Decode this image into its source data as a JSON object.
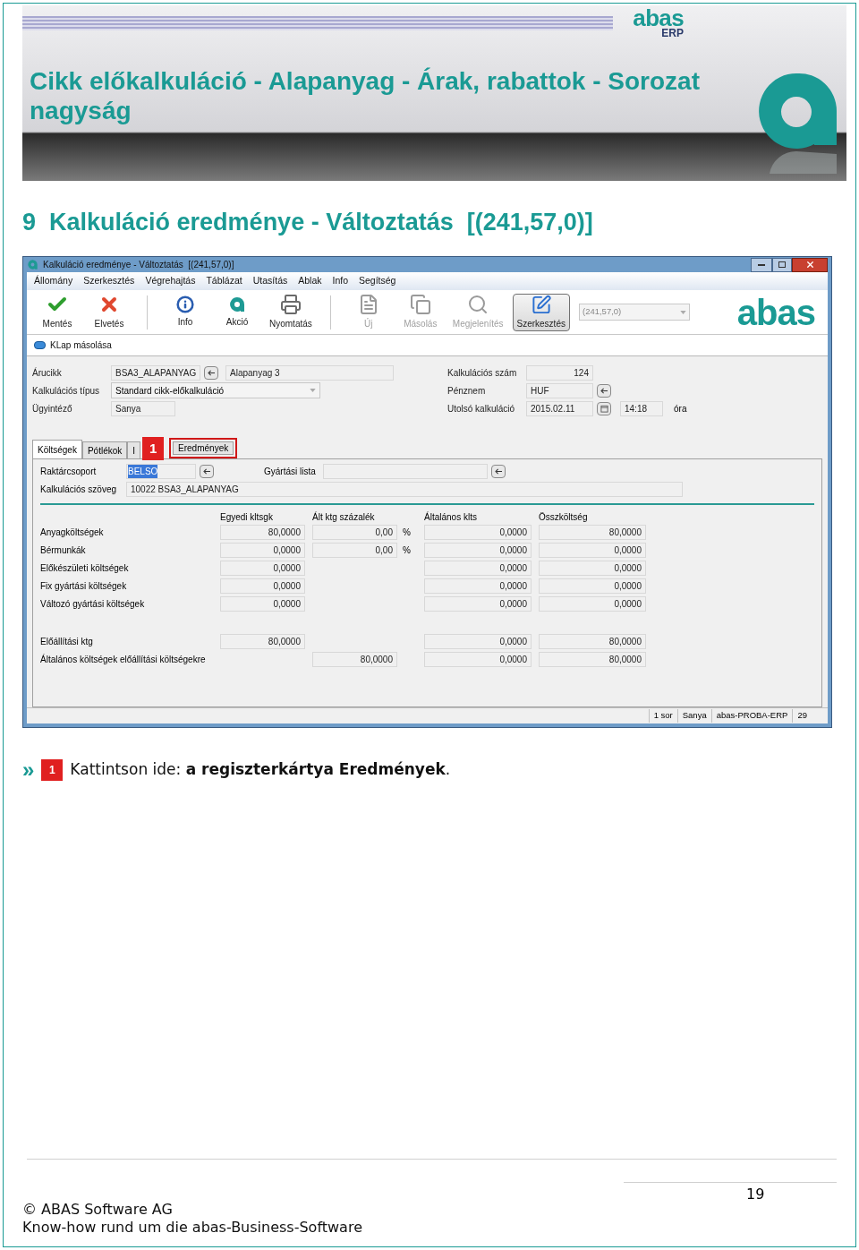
{
  "banner": {
    "logo": "abas",
    "logo_sub": "ERP",
    "title": "Cikk előkalkuláció - Alapanyag - Árak, rabattok - Sorozat nagyság"
  },
  "section": {
    "number": "9",
    "title": "Kalkuláció eredménye - Változtatás  [(241,57,0)]"
  },
  "window": {
    "title": "Kalkuláció eredménye - Változtatás  [(241,57,0)]",
    "menu": [
      "Állomány",
      "Szerkesztés",
      "Végrehajtás",
      "Táblázat",
      "Utasítás",
      "Ablak",
      "Info",
      "Segítség"
    ],
    "toolbar": [
      {
        "kind": "save",
        "label": "Mentés",
        "disabled": false,
        "selected": false
      },
      {
        "kind": "discard",
        "label": "Elvetés",
        "disabled": false,
        "selected": false
      },
      {
        "kind": "separator"
      },
      {
        "kind": "info",
        "label": "Info",
        "disabled": false,
        "selected": false
      },
      {
        "kind": "action",
        "label": "Akció",
        "disabled": false,
        "selected": false
      },
      {
        "kind": "print",
        "label": "Nyomtatás",
        "disabled": false,
        "selected": false
      },
      {
        "kind": "separator"
      },
      {
        "kind": "new",
        "label": "Új",
        "disabled": true,
        "selected": false
      },
      {
        "kind": "copy",
        "label": "Másolás",
        "disabled": true,
        "selected": false
      },
      {
        "kind": "view",
        "label": "Megjelenítés",
        "disabled": true,
        "selected": false
      },
      {
        "kind": "edit",
        "label": "Szerkesztés",
        "disabled": false,
        "selected": true
      }
    ],
    "record_select": {
      "value": "(241,57,0)"
    },
    "logo": "abas",
    "action": "KLap másolása",
    "fields_left": [
      {
        "label": "Árucikk",
        "kind": "lookup",
        "value": "BSA3_ALAPANYAG",
        "extra": "Alapanyag 3"
      },
      {
        "label": "Kalkulációs típus",
        "kind": "select",
        "value": "Standard cikk-előkalkuláció"
      },
      {
        "label": "Ügyintéző",
        "kind": "text",
        "value": "Sanya"
      }
    ],
    "fields_right": [
      {
        "label": "Kalkulációs szám",
        "kind": "number",
        "value": "124"
      },
      {
        "label": "Pénznem",
        "kind": "lookup",
        "value": "HUF"
      },
      {
        "label": "Utolsó kalkuláció",
        "kind": "date",
        "value": "2015.02.11",
        "time": "14:18",
        "unit": "óra"
      }
    ],
    "tabs": [
      {
        "label": "Költségek",
        "selected": true,
        "highlighted": false
      },
      {
        "label": "Pótlékok",
        "selected": false,
        "highlighted": false
      },
      {
        "label": "I",
        "selected": false,
        "highlighted": false
      },
      {
        "label": "Eredmények",
        "selected": false,
        "highlighted": true
      }
    ],
    "callout": "1",
    "stock_group": {
      "label": "Raktárcsoport",
      "value": "BELSO",
      "text_selected": true
    },
    "production_list": {
      "label": "Gyártási lista"
    },
    "calc_text": {
      "label": "Kalkulációs szöveg",
      "value": "10022 BSA3_ALAPANYAG"
    },
    "cost_columns": [
      "Egyedi kltsgk",
      "Ált ktg százalék",
      "Általános klts",
      "Összköltség"
    ],
    "cost_rows": [
      {
        "label": "Anyagköltségek",
        "cells": [
          "80,0000",
          "0,00",
          "0,0000",
          "80,0000"
        ],
        "unit": "%"
      },
      {
        "label": "Bérmunkák",
        "cells": [
          "0,0000",
          "0,00",
          "0,0000",
          "0,0000"
        ],
        "unit": "%"
      },
      {
        "label": "Előkészületi költségek",
        "cells": [
          "0,0000",
          null,
          "0,0000",
          "0,0000"
        ]
      },
      {
        "label": "Fix gyártási költségek",
        "cells": [
          "0,0000",
          null,
          "0,0000",
          "0,0000"
        ]
      },
      {
        "label": "Változó gyártási költségek",
        "cells": [
          "0,0000",
          null,
          "0,0000",
          "0,0000"
        ]
      }
    ],
    "total_rows": [
      {
        "label": "Előállítási ktg",
        "cells": [
          "80,0000",
          null,
          "0,0000",
          "80,0000"
        ]
      },
      {
        "label": "Általános költségek előállítási költségekre",
        "cells": [
          null,
          "80,0000",
          "0,0000",
          "80,0000"
        ]
      }
    ],
    "status_bar": [
      "1 sor",
      "Sanya",
      "abas-PROBA-ERP",
      "29"
    ]
  },
  "instruction": {
    "marker": "»",
    "badge": "1",
    "text": "Kattintson ide: **a regiszterkártya Eredmények**."
  },
  "footer": {
    "page": "19",
    "copyright": "© ABAS Software AG",
    "tagline": "Know-how rund um die abas-Business-Software"
  }
}
